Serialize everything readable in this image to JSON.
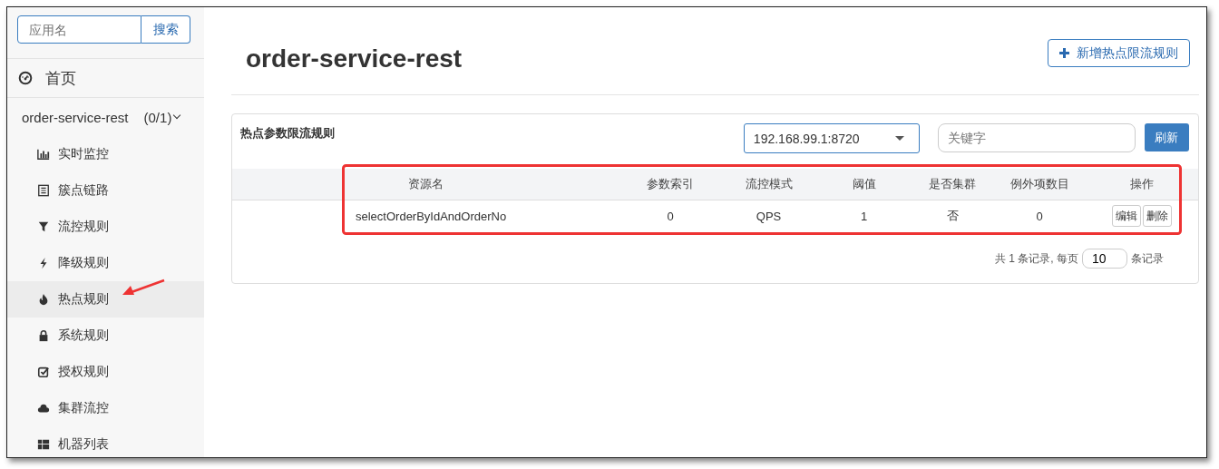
{
  "sidebar": {
    "search": {
      "placeholder": "应用名",
      "button": "搜索"
    },
    "home": {
      "label": "首页"
    },
    "app": {
      "name": "order-service-rest",
      "count": "(0/1)",
      "expanded": true
    },
    "items": [
      {
        "kind": "chart",
        "label": "实时监控",
        "selected": false
      },
      {
        "kind": "list",
        "label": "簇点链路",
        "selected": false
      },
      {
        "kind": "filter",
        "label": "流控规则",
        "selected": false
      },
      {
        "kind": "bolt",
        "label": "降级规则",
        "selected": false
      },
      {
        "kind": "fire",
        "label": "热点规则",
        "selected": true
      },
      {
        "kind": "lock",
        "label": "系统规则",
        "selected": false
      },
      {
        "kind": "check",
        "label": "授权规则",
        "selected": false
      },
      {
        "kind": "cloud",
        "label": "集群流控",
        "selected": false
      },
      {
        "kind": "grid",
        "label": "机器列表",
        "selected": false
      }
    ]
  },
  "page": {
    "title": "order-service-rest",
    "add_button": "新增热点限流规则"
  },
  "panel": {
    "title": "热点参数限流规则",
    "machine": "192.168.99.1:8720",
    "keyword_placeholder": "关键字",
    "refresh_button": "刷新",
    "table": {
      "columns": [
        "资源名",
        "参数索引",
        "流控模式",
        "阈值",
        "是否集群",
        "例外项数目",
        "操作"
      ],
      "rows": [
        {
          "cells": [
            "selectOrderByIdAndOrderNo",
            "0",
            "QPS",
            "1",
            "否",
            "0"
          ],
          "actions": [
            "编辑",
            "删除"
          ]
        }
      ]
    },
    "pagination": {
      "prefix": "共 1 条记录, 每页",
      "page_size": "10",
      "suffix": "条记录"
    }
  }
}
